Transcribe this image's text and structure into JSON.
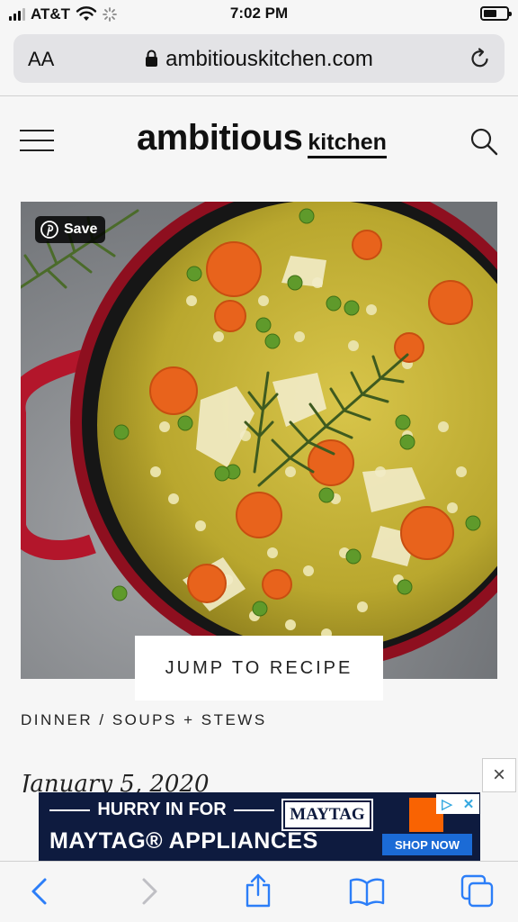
{
  "status_bar": {
    "carrier": "AT&T",
    "time": "7:02 PM"
  },
  "browser": {
    "text_size_label": "AA",
    "url": "ambitiouskitchen.com"
  },
  "site": {
    "logo_main": "ambitious",
    "logo_sub": "kitchen"
  },
  "hero": {
    "pin_save_label": "Save",
    "jump_label": "JUMP TO RECIPE"
  },
  "post": {
    "breadcrumbs": "DINNER /  SOUPS + STEWS",
    "date": "January 5, 2020"
  },
  "ad": {
    "headline": "HURRY IN FOR",
    "line2": "MAYTAG® APPLIANCES",
    "brand": "MAYTAG",
    "cta": "SHOP NOW",
    "close_label": "×"
  },
  "colors": {
    "pot_red": "#b3162b",
    "broth": "#b9a72e",
    "ad_navy": "#0e1b3f",
    "ad_cta": "#1b6bd6",
    "ios_blue": "#2c7ef8"
  }
}
